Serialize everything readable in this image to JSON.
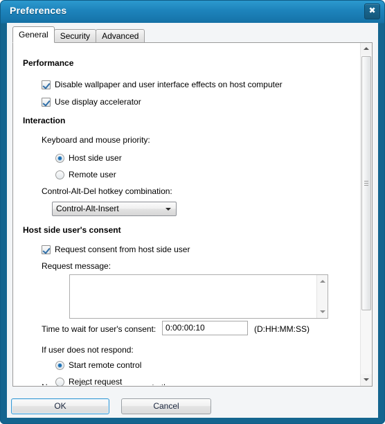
{
  "window": {
    "title": "Preferences",
    "close_icon": "close-icon",
    "close_glyph": "✖",
    "titlebar_color": "#1777ad",
    "accent_color": "#1b6fb5"
  },
  "tabs": [
    {
      "label": "General",
      "active": true
    },
    {
      "label": "Security",
      "active": false
    },
    {
      "label": "Advanced",
      "active": false
    }
  ],
  "general": {
    "performance": {
      "heading": "Performance",
      "items": [
        {
          "label": "Disable wallpaper and user interface effects on host computer",
          "checked": true
        },
        {
          "label": "Use display accelerator",
          "checked": true
        }
      ]
    },
    "interaction": {
      "heading": "Interaction",
      "priority_label": "Keyboard and mouse priority:",
      "priority_options": [
        {
          "label": "Host side user",
          "selected": true
        },
        {
          "label": "Remote user",
          "selected": false
        }
      ],
      "hotkey_label": "Control-Alt-Del hotkey combination:",
      "hotkey_value": "Control-Alt-Insert"
    },
    "consent": {
      "heading": "Host side user's consent",
      "request_consent": {
        "label": "Request consent from host side user",
        "checked": true
      },
      "message_label": "Request message:",
      "message_value": "",
      "wait_label": "Time to wait for user's consent:",
      "wait_value": "0:00:00:10",
      "wait_format": "(D:HH:MM:SS)",
      "no_respond_label": "If user does not respond:",
      "no_respond_options": [
        {
          "label": "Start remote control",
          "selected": true
        },
        {
          "label": "Reject request",
          "selected": false
        }
      ],
      "cutoff_row": "No request for screen access to the"
    }
  },
  "scrollbar": {
    "up_arrow_icon": "scroll-up-arrow-icon",
    "down_arrow_icon": "scroll-down-arrow-icon",
    "thumb_icon": "scroll-thumb-grip-icon"
  },
  "buttons": {
    "ok": "OK",
    "cancel": "Cancel"
  }
}
